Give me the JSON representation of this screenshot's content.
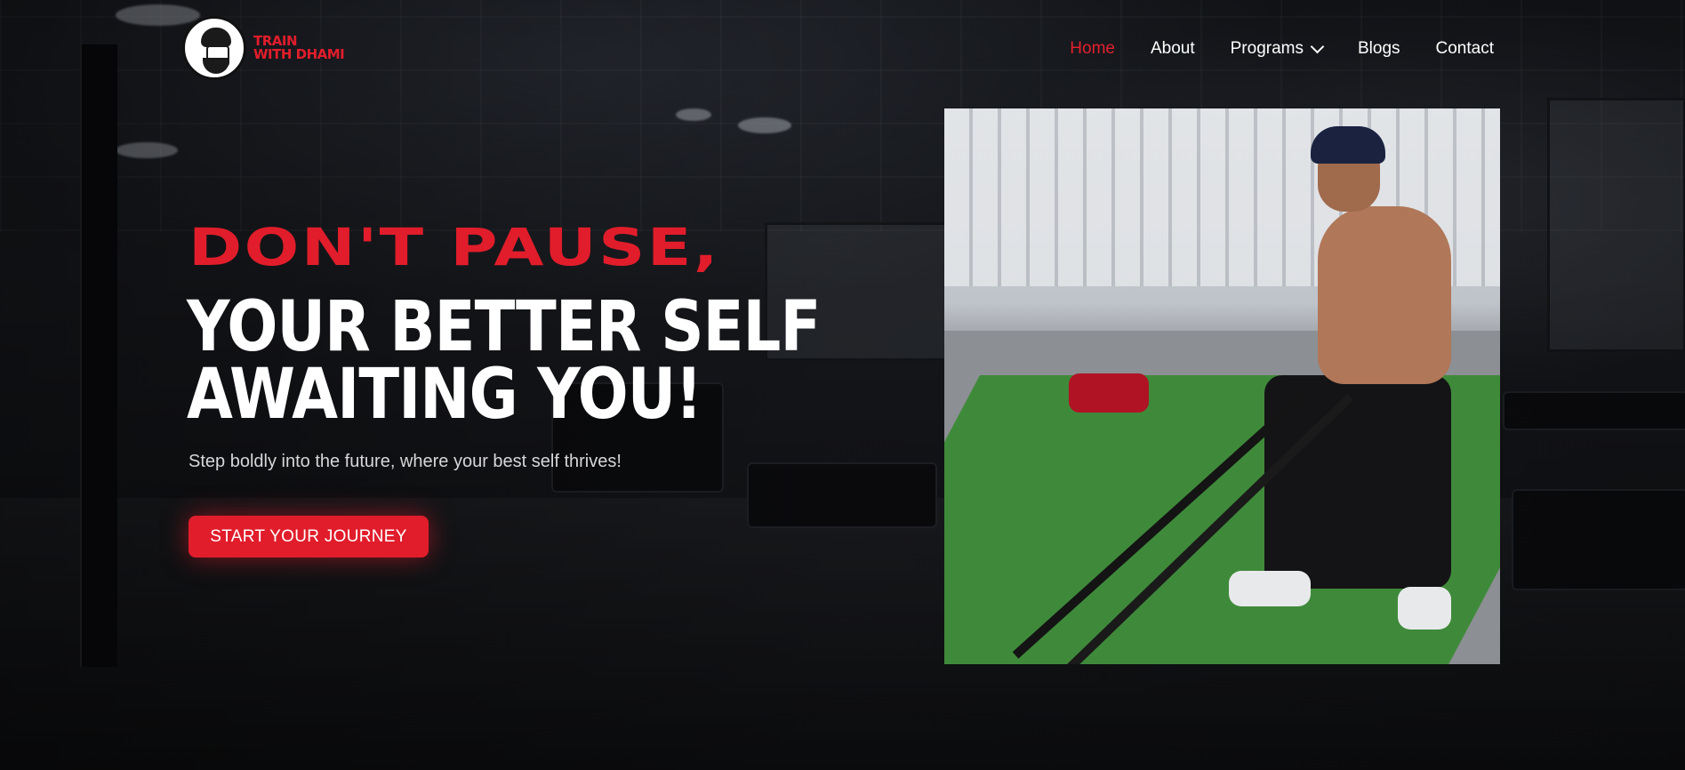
{
  "brand": {
    "line1": "TRAIN",
    "line2": "WITH DHAMI",
    "accent": "#e11d2b"
  },
  "nav": {
    "items": [
      {
        "label": "Home",
        "active": true
      },
      {
        "label": "About"
      },
      {
        "label": "Programs",
        "has_dropdown": true
      },
      {
        "label": "Blogs"
      },
      {
        "label": "Contact"
      }
    ]
  },
  "hero": {
    "pretitle": "DON'T PAUSE,",
    "title_line1": "YOUR BETTER SELF",
    "title_line2": "AWAITING YOU!",
    "subtitle": "Step boldly into the future, where your best self thrives!",
    "cta_label": "START YOUR JOURNEY"
  },
  "colors": {
    "primary": "#e11d2b",
    "background": "#0b0c0f",
    "text": "#ffffff"
  }
}
